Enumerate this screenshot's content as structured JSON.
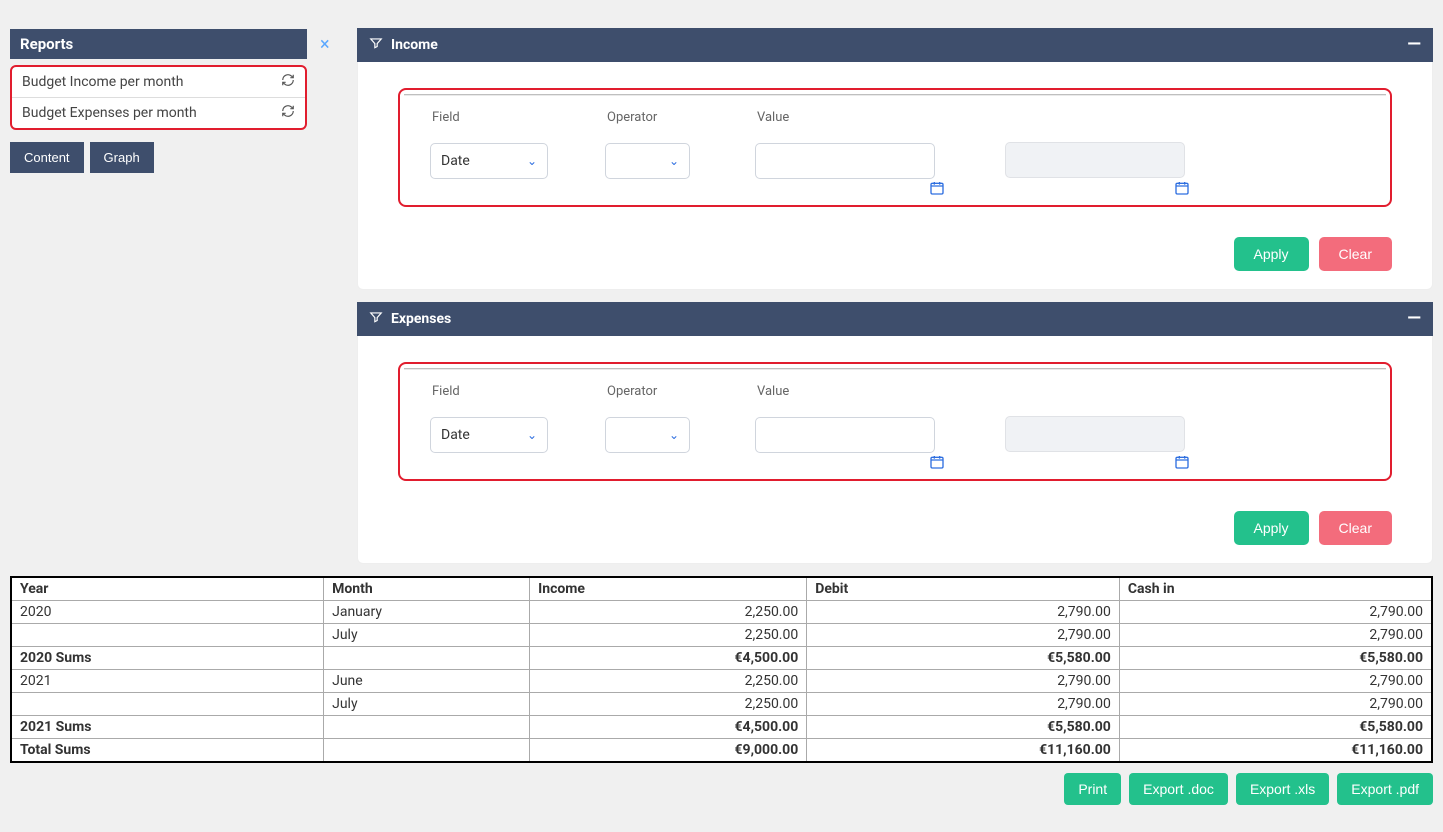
{
  "sidebar": {
    "title": "Reports",
    "items": [
      {
        "label": "Budget Income per month"
      },
      {
        "label": "Budget Expenses per month"
      }
    ],
    "buttons": {
      "content": "Content",
      "graph": "Graph"
    }
  },
  "closeX": "×",
  "filterPanels": [
    {
      "title": "Income",
      "labels": {
        "field": "Field",
        "operator": "Operator",
        "value": "Value"
      },
      "fieldValue": "Date",
      "apply": "Apply",
      "clear": "Clear"
    },
    {
      "title": "Expenses",
      "labels": {
        "field": "Field",
        "operator": "Operator",
        "value": "Value"
      },
      "fieldValue": "Date",
      "apply": "Apply",
      "clear": "Clear"
    }
  ],
  "table": {
    "headers": {
      "year": "Year",
      "month": "Month",
      "income": "Income",
      "debit": "Debit",
      "cash": "Cash in"
    },
    "rows": [
      {
        "year": "2020",
        "month": "January",
        "income": "2,250.00",
        "debit": "2,790.00",
        "cash": "2,790.00"
      },
      {
        "year": "",
        "month": "July",
        "income": "2,250.00",
        "debit": "2,790.00",
        "cash": "2,790.00"
      },
      {
        "year": "2020 Sums",
        "month": "",
        "income": "€4,500.00",
        "debit": "€5,580.00",
        "cash": "€5,580.00",
        "sums": true
      },
      {
        "year": "2021",
        "month": "June",
        "income": "2,250.00",
        "debit": "2,790.00",
        "cash": "2,790.00"
      },
      {
        "year": "",
        "month": "July",
        "income": "2,250.00",
        "debit": "2,790.00",
        "cash": "2,790.00"
      },
      {
        "year": "2021 Sums",
        "month": "",
        "income": "€4,500.00",
        "debit": "€5,580.00",
        "cash": "€5,580.00",
        "sums": true
      },
      {
        "year": "Total Sums",
        "month": "",
        "income": "€9,000.00",
        "debit": "€11,160.00",
        "cash": "€11,160.00",
        "sums": true
      }
    ]
  },
  "exports": {
    "print": "Print",
    "doc": "Export .doc",
    "xls": "Export .xls",
    "pdf": "Export .pdf"
  }
}
